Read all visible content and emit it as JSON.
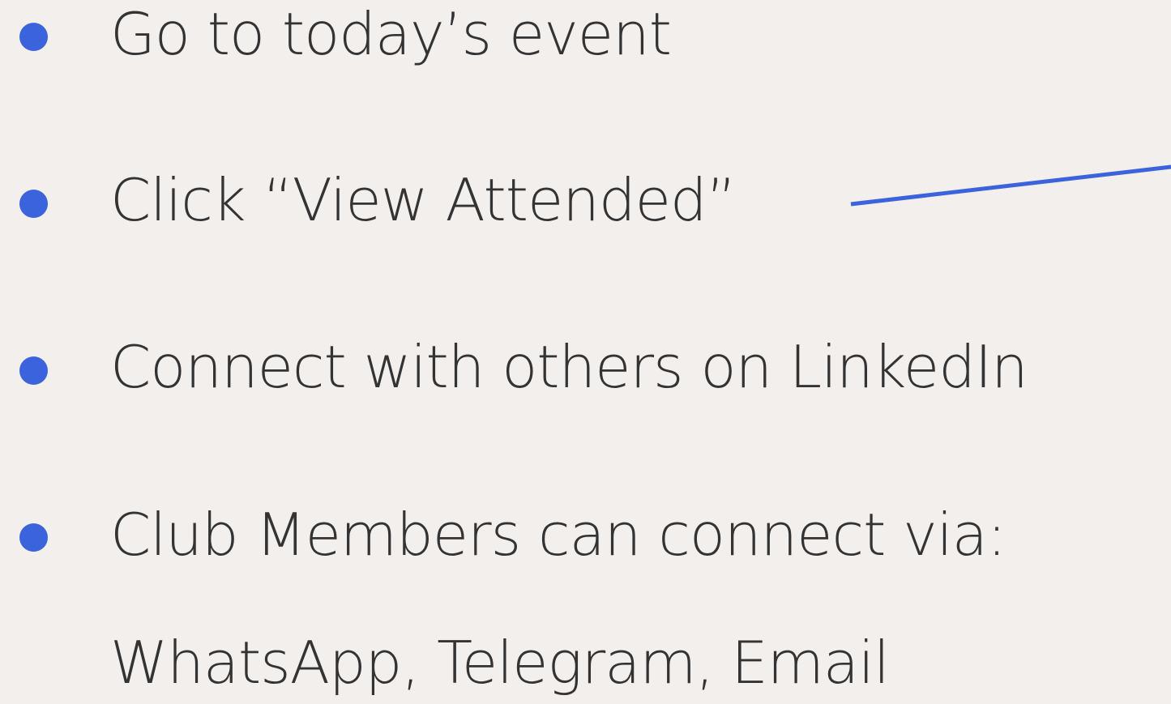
{
  "steps": [
    {
      "text": "Go to today’s event"
    },
    {
      "text": "Click “View Attended”"
    },
    {
      "text": "Connect with others on LinkedIn"
    },
    {
      "text": "Club Members can connect via:"
    }
  ],
  "continuation": "WhatsApp, Telegram, Email",
  "colors": {
    "background": "#f3efec",
    "bullet": "#3b63dc",
    "text": "#333333",
    "pointer_line": "#3b63dc"
  }
}
